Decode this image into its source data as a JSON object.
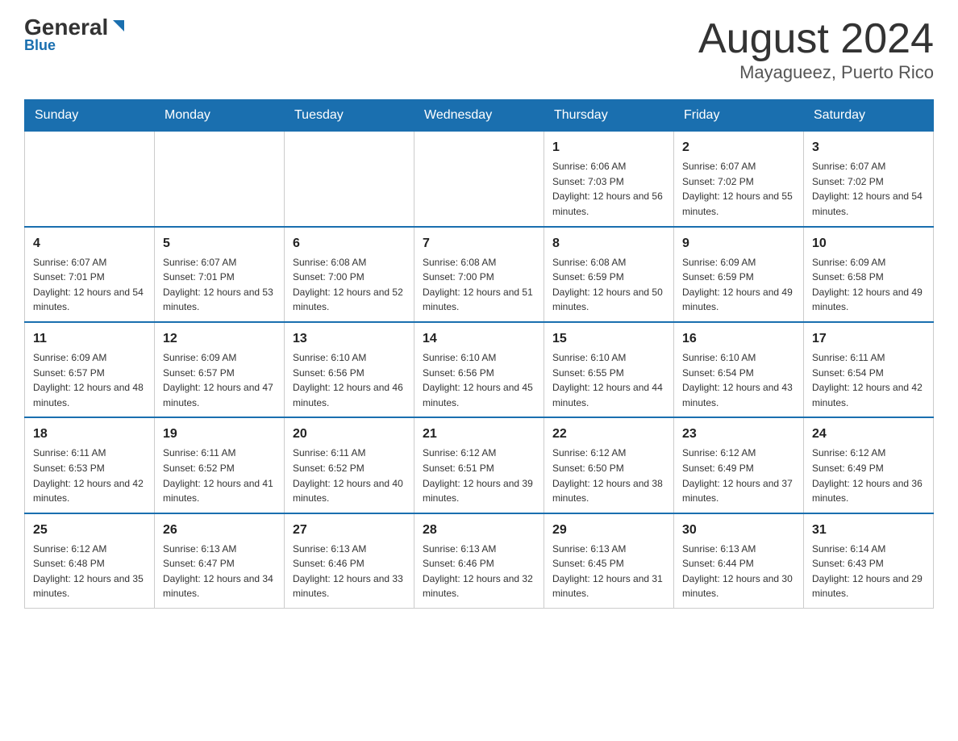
{
  "header": {
    "logo_general": "General",
    "logo_blue": "Blue",
    "title": "August 2024",
    "subtitle": "Mayagueez, Puerto Rico"
  },
  "days_of_week": [
    "Sunday",
    "Monday",
    "Tuesday",
    "Wednesday",
    "Thursday",
    "Friday",
    "Saturday"
  ],
  "weeks": [
    [
      {
        "day": "",
        "sunrise": "",
        "sunset": "",
        "daylight": ""
      },
      {
        "day": "",
        "sunrise": "",
        "sunset": "",
        "daylight": ""
      },
      {
        "day": "",
        "sunrise": "",
        "sunset": "",
        "daylight": ""
      },
      {
        "day": "",
        "sunrise": "",
        "sunset": "",
        "daylight": ""
      },
      {
        "day": "1",
        "sunrise": "Sunrise: 6:06 AM",
        "sunset": "Sunset: 7:03 PM",
        "daylight": "Daylight: 12 hours and 56 minutes."
      },
      {
        "day": "2",
        "sunrise": "Sunrise: 6:07 AM",
        "sunset": "Sunset: 7:02 PM",
        "daylight": "Daylight: 12 hours and 55 minutes."
      },
      {
        "day": "3",
        "sunrise": "Sunrise: 6:07 AM",
        "sunset": "Sunset: 7:02 PM",
        "daylight": "Daylight: 12 hours and 54 minutes."
      }
    ],
    [
      {
        "day": "4",
        "sunrise": "Sunrise: 6:07 AM",
        "sunset": "Sunset: 7:01 PM",
        "daylight": "Daylight: 12 hours and 54 minutes."
      },
      {
        "day": "5",
        "sunrise": "Sunrise: 6:07 AM",
        "sunset": "Sunset: 7:01 PM",
        "daylight": "Daylight: 12 hours and 53 minutes."
      },
      {
        "day": "6",
        "sunrise": "Sunrise: 6:08 AM",
        "sunset": "Sunset: 7:00 PM",
        "daylight": "Daylight: 12 hours and 52 minutes."
      },
      {
        "day": "7",
        "sunrise": "Sunrise: 6:08 AM",
        "sunset": "Sunset: 7:00 PM",
        "daylight": "Daylight: 12 hours and 51 minutes."
      },
      {
        "day": "8",
        "sunrise": "Sunrise: 6:08 AM",
        "sunset": "Sunset: 6:59 PM",
        "daylight": "Daylight: 12 hours and 50 minutes."
      },
      {
        "day": "9",
        "sunrise": "Sunrise: 6:09 AM",
        "sunset": "Sunset: 6:59 PM",
        "daylight": "Daylight: 12 hours and 49 minutes."
      },
      {
        "day": "10",
        "sunrise": "Sunrise: 6:09 AM",
        "sunset": "Sunset: 6:58 PM",
        "daylight": "Daylight: 12 hours and 49 minutes."
      }
    ],
    [
      {
        "day": "11",
        "sunrise": "Sunrise: 6:09 AM",
        "sunset": "Sunset: 6:57 PM",
        "daylight": "Daylight: 12 hours and 48 minutes."
      },
      {
        "day": "12",
        "sunrise": "Sunrise: 6:09 AM",
        "sunset": "Sunset: 6:57 PM",
        "daylight": "Daylight: 12 hours and 47 minutes."
      },
      {
        "day": "13",
        "sunrise": "Sunrise: 6:10 AM",
        "sunset": "Sunset: 6:56 PM",
        "daylight": "Daylight: 12 hours and 46 minutes."
      },
      {
        "day": "14",
        "sunrise": "Sunrise: 6:10 AM",
        "sunset": "Sunset: 6:56 PM",
        "daylight": "Daylight: 12 hours and 45 minutes."
      },
      {
        "day": "15",
        "sunrise": "Sunrise: 6:10 AM",
        "sunset": "Sunset: 6:55 PM",
        "daylight": "Daylight: 12 hours and 44 minutes."
      },
      {
        "day": "16",
        "sunrise": "Sunrise: 6:10 AM",
        "sunset": "Sunset: 6:54 PM",
        "daylight": "Daylight: 12 hours and 43 minutes."
      },
      {
        "day": "17",
        "sunrise": "Sunrise: 6:11 AM",
        "sunset": "Sunset: 6:54 PM",
        "daylight": "Daylight: 12 hours and 42 minutes."
      }
    ],
    [
      {
        "day": "18",
        "sunrise": "Sunrise: 6:11 AM",
        "sunset": "Sunset: 6:53 PM",
        "daylight": "Daylight: 12 hours and 42 minutes."
      },
      {
        "day": "19",
        "sunrise": "Sunrise: 6:11 AM",
        "sunset": "Sunset: 6:52 PM",
        "daylight": "Daylight: 12 hours and 41 minutes."
      },
      {
        "day": "20",
        "sunrise": "Sunrise: 6:11 AM",
        "sunset": "Sunset: 6:52 PM",
        "daylight": "Daylight: 12 hours and 40 minutes."
      },
      {
        "day": "21",
        "sunrise": "Sunrise: 6:12 AM",
        "sunset": "Sunset: 6:51 PM",
        "daylight": "Daylight: 12 hours and 39 minutes."
      },
      {
        "day": "22",
        "sunrise": "Sunrise: 6:12 AM",
        "sunset": "Sunset: 6:50 PM",
        "daylight": "Daylight: 12 hours and 38 minutes."
      },
      {
        "day": "23",
        "sunrise": "Sunrise: 6:12 AM",
        "sunset": "Sunset: 6:49 PM",
        "daylight": "Daylight: 12 hours and 37 minutes."
      },
      {
        "day": "24",
        "sunrise": "Sunrise: 6:12 AM",
        "sunset": "Sunset: 6:49 PM",
        "daylight": "Daylight: 12 hours and 36 minutes."
      }
    ],
    [
      {
        "day": "25",
        "sunrise": "Sunrise: 6:12 AM",
        "sunset": "Sunset: 6:48 PM",
        "daylight": "Daylight: 12 hours and 35 minutes."
      },
      {
        "day": "26",
        "sunrise": "Sunrise: 6:13 AM",
        "sunset": "Sunset: 6:47 PM",
        "daylight": "Daylight: 12 hours and 34 minutes."
      },
      {
        "day": "27",
        "sunrise": "Sunrise: 6:13 AM",
        "sunset": "Sunset: 6:46 PM",
        "daylight": "Daylight: 12 hours and 33 minutes."
      },
      {
        "day": "28",
        "sunrise": "Sunrise: 6:13 AM",
        "sunset": "Sunset: 6:46 PM",
        "daylight": "Daylight: 12 hours and 32 minutes."
      },
      {
        "day": "29",
        "sunrise": "Sunrise: 6:13 AM",
        "sunset": "Sunset: 6:45 PM",
        "daylight": "Daylight: 12 hours and 31 minutes."
      },
      {
        "day": "30",
        "sunrise": "Sunrise: 6:13 AM",
        "sunset": "Sunset: 6:44 PM",
        "daylight": "Daylight: 12 hours and 30 minutes."
      },
      {
        "day": "31",
        "sunrise": "Sunrise: 6:14 AM",
        "sunset": "Sunset: 6:43 PM",
        "daylight": "Daylight: 12 hours and 29 minutes."
      }
    ]
  ]
}
